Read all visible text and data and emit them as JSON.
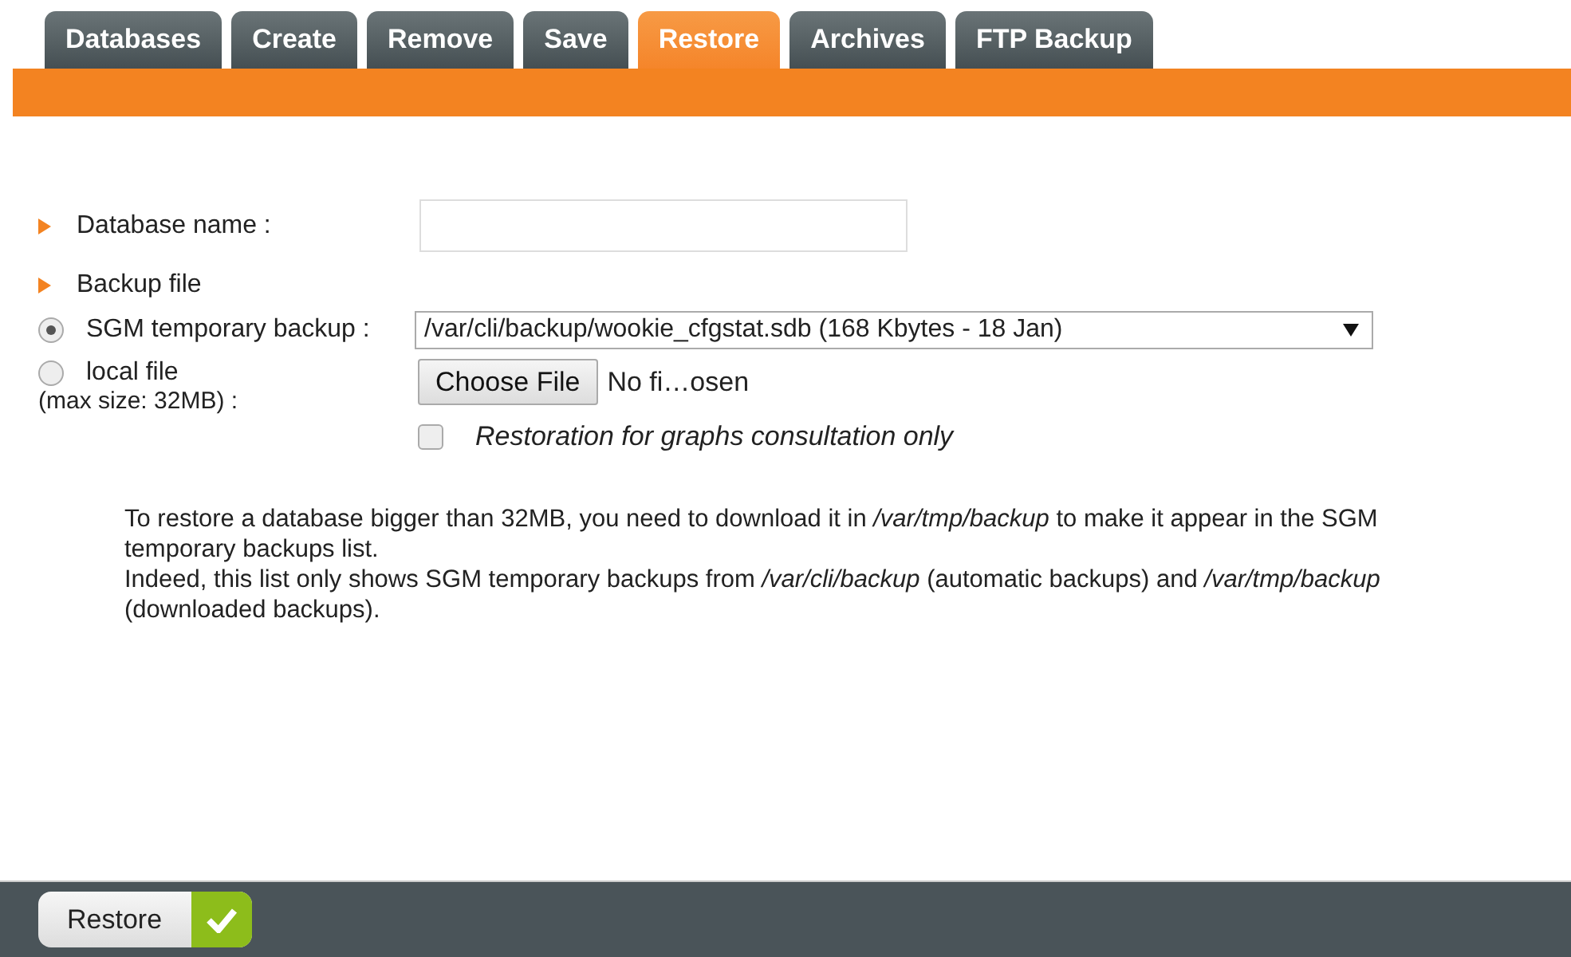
{
  "tabs": [
    {
      "label": "Databases",
      "selected": false
    },
    {
      "label": "Create",
      "selected": false
    },
    {
      "label": "Remove",
      "selected": false
    },
    {
      "label": "Save",
      "selected": false
    },
    {
      "label": "Restore",
      "selected": true
    },
    {
      "label": "Archives",
      "selected": false
    },
    {
      "label": "FTP Backup",
      "selected": false
    }
  ],
  "database_name": {
    "label": "Database name :"
  },
  "backup_file": {
    "label": "Backup file"
  },
  "sources": [
    {
      "label": "SGM temporary backup :",
      "selected": true,
      "kind": "select",
      "value": "/var/cli/backup/wookie_cfgstat.sdb (168 Kbytes - 18 Jan)"
    },
    {
      "label": "local file",
      "note": "(max size: 32MB) :",
      "selected": false,
      "kind": "file",
      "button": "Choose File",
      "value": "No fi…osen"
    }
  ],
  "graphs_only": {
    "label": "Restoration for graphs consultation only",
    "checked": false
  },
  "info": [
    "To restore a database bigger than 32MB, you need to download it in */var/tmp/backup* to make it appear in the SGM temporary backups list.",
    "Indeed, this list only shows SGM temporary backups from */var/cli/backup* (automatic backups) and */var/tmp/backup* (downloaded backups)."
  ],
  "footer": {
    "button": "Restore"
  }
}
